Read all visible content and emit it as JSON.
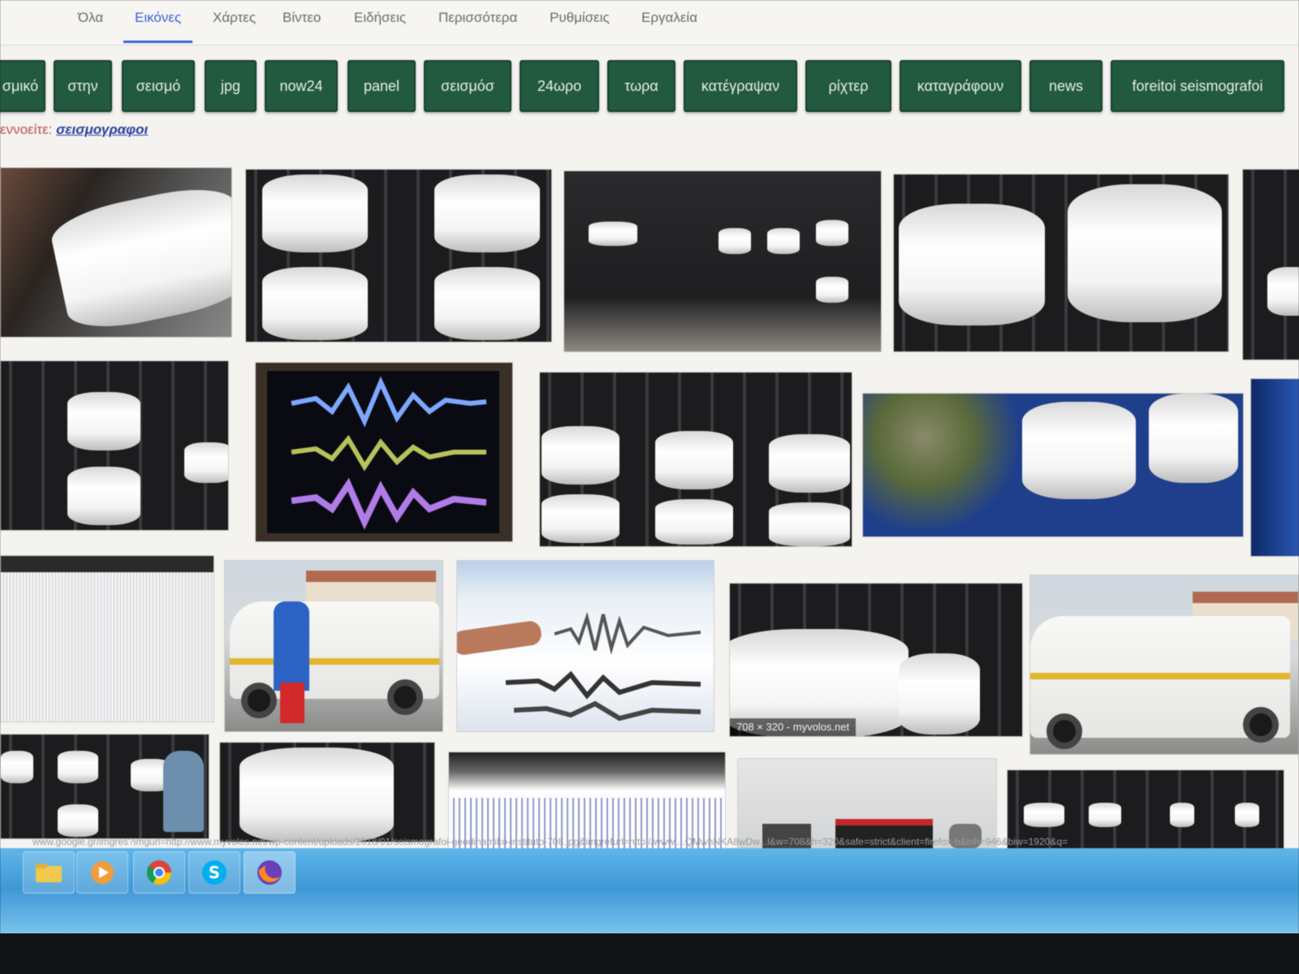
{
  "nav": {
    "tabs": [
      {
        "label": "Όλα",
        "active": false
      },
      {
        "label": "Εικόνες",
        "active": true
      },
      {
        "label": "Χάρτες",
        "active": false
      },
      {
        "label": "Βίντεο",
        "active": false
      },
      {
        "label": "Ειδήσεις",
        "active": false
      },
      {
        "label": "Περισσότερα",
        "active": false
      },
      {
        "label": "Ρυθμίσεις",
        "active": false
      },
      {
        "label": "Εργαλεία",
        "active": false
      }
    ]
  },
  "chips": [
    "σμικό",
    "στην",
    "σεισμό",
    "jpg",
    "now24",
    "panel",
    "σεισμόσ",
    "24ωρο",
    "τωρα",
    "κατέγραψαν",
    "ρίχτερ",
    "καταγράφουν",
    "news",
    "foreitoi seismografoi"
  ],
  "suggestion": {
    "prefix": "εννοείτε:",
    "link": "σεισμογραφοι"
  },
  "results": {
    "caption_tile_15": "708 × 320 - myvolos.net"
  },
  "statusbar": {
    "url": "www.google.gr/imgres?imgurl=http://www.myvolos.net/wp-content/uploads/2018/01/seismografoi-geodinamiko-instituto-708.jpg&imgrefurl=http://www....QMwhNKA8wDw...l&w=708&h=320&safe=strict&client=firefox-b&bih=946&biw=1920&q="
  },
  "taskbar": {
    "icons": [
      "folder-icon",
      "media-player-icon",
      "chrome-icon",
      "skype-icon",
      "firefox-icon"
    ]
  },
  "colors": {
    "chip_bg": "#225a3f",
    "active_tab": "#3b5fd8",
    "taskbar": "#4aa6df"
  }
}
